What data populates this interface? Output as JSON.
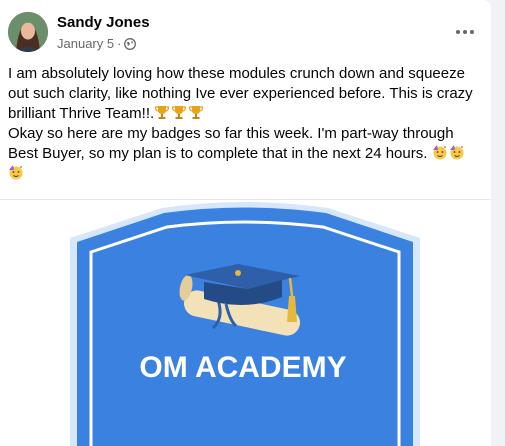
{
  "post": {
    "author": "Sandy Jones",
    "date": "January 5",
    "separator": "·",
    "privacy_icon": "globe-icon",
    "more_icon": "more-options-icon",
    "line1": "I am absolutely loving how these modules crunch down and squeeze out such clarity, like nothing Ive ever experienced before. This is crazy brilliant Thrive Team!!.",
    "line1_emoji": [
      "trophy",
      "trophy",
      "trophy"
    ],
    "line2": " Okay so here are my badges so far this week. I'm part-way through Best Buyer, so my plan is to complete that in the next 24 hours.",
    "line2_emoji": [
      "partying-face",
      "partying-face",
      "partying-face"
    ]
  },
  "image": {
    "badge_text": "OM ACADEMY",
    "colors": {
      "shield": "#3b82e0",
      "shield_border": "#d6e6fb",
      "cap": "#2e5fa8",
      "tassel": "#e6b83c",
      "scroll": "#f3e2b8"
    }
  }
}
